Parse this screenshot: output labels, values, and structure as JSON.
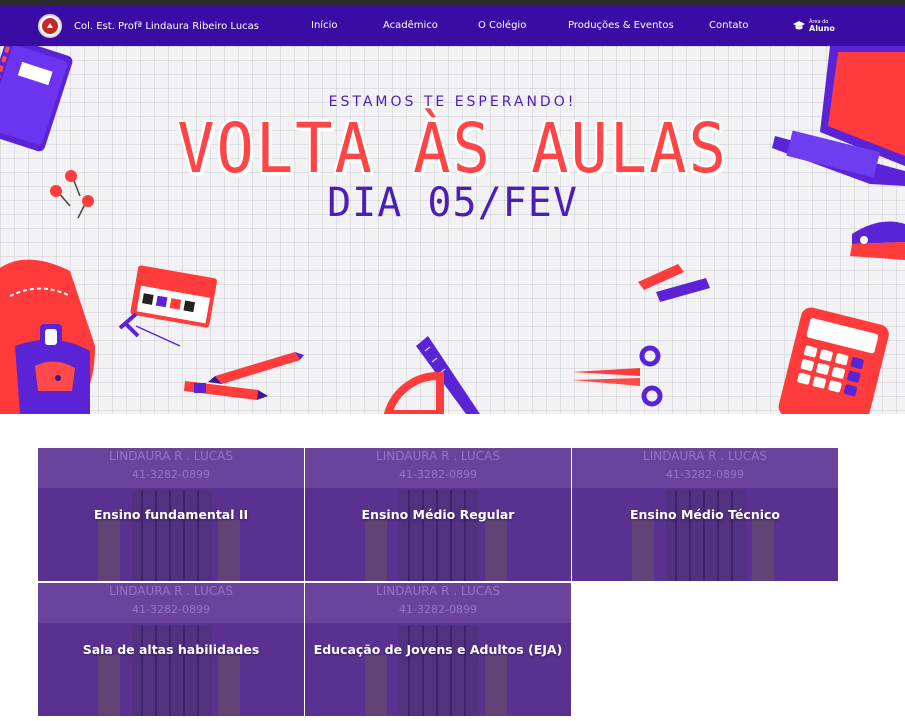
{
  "header": {
    "school_name": "Col. Est. Profª Lindaura Ribeiro Lucas",
    "nav": [
      {
        "label": "Início"
      },
      {
        "label": "Acadêmico"
      },
      {
        "label": "O Colégio"
      },
      {
        "label": "Produções & Eventos"
      },
      {
        "label": "Contato"
      }
    ],
    "student_area": {
      "small": "Área do",
      "big": "Aluno"
    }
  },
  "hero": {
    "subtitle": "ESTAMOS TE ESPERANDO!",
    "title": "VOLTA ÀS AULAS",
    "date": "DIA 05/FEV"
  },
  "cards": [
    {
      "label": "Ensino fundamental II",
      "photo_text": "LINDAURA R . LUCAS",
      "photo_phone": "41-3282-0899"
    },
    {
      "label": "Ensino Médio Regular",
      "photo_text": "LINDAURA R . LUCAS",
      "photo_phone": "41-3282-0899"
    },
    {
      "label": "Ensino Médio Técnico",
      "photo_text": "LINDAURA R . LUCAS",
      "photo_phone": "41-3282-0899"
    },
    {
      "label": "Sala de altas habilidades",
      "photo_text": "LINDAURA R . LUCAS",
      "photo_phone": "41-3282-0899"
    },
    {
      "label": "Educação de Jovens e Adultos (EJA)",
      "photo_text": "LINDAURA R . LUCAS",
      "photo_phone": "41-3282-0899"
    }
  ],
  "colors": {
    "nav_bg": "#3a0ca3",
    "hero_red": "#ff4545",
    "hero_purple": "#4a1fb8",
    "card_overlay": "#46148f"
  }
}
